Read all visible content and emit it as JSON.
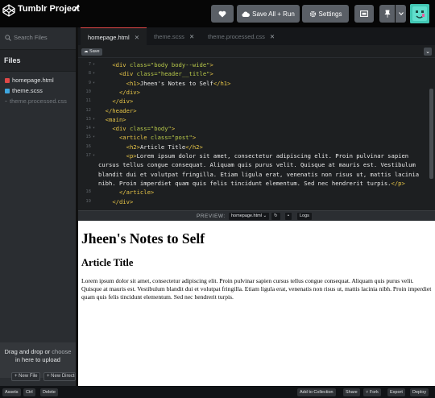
{
  "header": {
    "project_title": "Tumblr Project",
    "save_all_label": "Save All + Run",
    "settings_label": "Settings"
  },
  "sidebar": {
    "search_placeholder": "Search Files",
    "files_heading": "Files",
    "files": [
      {
        "name": "homepage.html",
        "color": "#e04848"
      },
      {
        "name": "theme.scss",
        "color": "#3fa7e0"
      },
      {
        "name": "theme.processed.css",
        "color": "#555a5f"
      }
    ],
    "upload_text_1": "Drag and drop or",
    "upload_link": "choose",
    "upload_text_2": "in here to upload",
    "new_file_label": "+ New File",
    "new_directory_label": "+ New Directo"
  },
  "tabs": [
    {
      "label": "homepage.html",
      "active": true
    },
    {
      "label": "theme.scss",
      "active": false
    },
    {
      "label": "theme.processed.css",
      "active": false
    }
  ],
  "editor": {
    "save_label": "Save",
    "lines": [
      {
        "num": "7",
        "fold": "▾",
        "indent": "    ",
        "parts": [
          [
            "tag",
            "<div "
          ],
          [
            "attr",
            "class="
          ],
          [
            "str",
            "\"body body--wide\""
          ],
          [
            "tag",
            ">"
          ]
        ]
      },
      {
        "num": "8",
        "fold": "▾",
        "indent": "      ",
        "parts": [
          [
            "tag",
            "<div "
          ],
          [
            "attr",
            "class="
          ],
          [
            "str",
            "\"header__title\""
          ],
          [
            "tag",
            ">"
          ]
        ]
      },
      {
        "num": "9",
        "fold": "▾",
        "indent": "        ",
        "parts": [
          [
            "tag",
            "<h1>"
          ],
          [
            "txt",
            "Jheen's Notes to Self"
          ],
          [
            "tag",
            "</h1>"
          ]
        ]
      },
      {
        "num": "10",
        "fold": "",
        "indent": "      ",
        "parts": [
          [
            "tag",
            "</div>"
          ]
        ]
      },
      {
        "num": "11",
        "fold": "",
        "indent": "    ",
        "parts": [
          [
            "tag",
            "</div>"
          ]
        ]
      },
      {
        "num": "12",
        "fold": "",
        "indent": "  ",
        "parts": [
          [
            "tag",
            "</header>"
          ]
        ]
      },
      {
        "num": "13",
        "fold": "▾",
        "indent": "  ",
        "parts": [
          [
            "tag",
            "<main>"
          ]
        ]
      },
      {
        "num": "14",
        "fold": "▾",
        "indent": "    ",
        "parts": [
          [
            "tag",
            "<div "
          ],
          [
            "attr",
            "class="
          ],
          [
            "str",
            "\"body\""
          ],
          [
            "tag",
            ">"
          ]
        ]
      },
      {
        "num": "15",
        "fold": "▾",
        "indent": "      ",
        "parts": [
          [
            "tag",
            "<article "
          ],
          [
            "attr",
            "class="
          ],
          [
            "str",
            "\"post\""
          ],
          [
            "tag",
            ">"
          ]
        ]
      },
      {
        "num": "16",
        "fold": "",
        "indent": "        ",
        "parts": [
          [
            "tag",
            "<h2>"
          ],
          [
            "txt",
            "Article Title"
          ],
          [
            "tag",
            "</h2>"
          ]
        ]
      },
      {
        "num": "17",
        "fold": "▾",
        "indent": "        ",
        "parts": [
          [
            "tag",
            "<p>"
          ],
          [
            "txt",
            "Lorem ipsum dolor sit amet, consectetur adipiscing elit. Proin pulvinar sapien"
          ]
        ]
      },
      {
        "num": "",
        "fold": "",
        "indent": "",
        "parts": [
          [
            "txt",
            "cursus tellus congue consequat. Aliquam quis purus velit. Quisque at mauris est. Vestibulum"
          ]
        ]
      },
      {
        "num": "",
        "fold": "",
        "indent": "",
        "parts": [
          [
            "txt",
            "blandit dui et volutpat fringilla. Etiam ligula erat, venenatis non risus ut, mattis lacinia"
          ]
        ]
      },
      {
        "num": "",
        "fold": "",
        "indent": "",
        "parts": [
          [
            "txt",
            "nibh. Proin imperdiet quam quis felis tincidunt elementum. Sed nec hendrerit turpis."
          ],
          [
            "tag",
            "</p>"
          ]
        ]
      },
      {
        "num": "18",
        "fold": "",
        "indent": "      ",
        "parts": [
          [
            "tag",
            "</article>"
          ]
        ]
      },
      {
        "num": "19",
        "fold": "",
        "indent": "    ",
        "parts": [
          [
            "tag",
            "</div>"
          ]
        ]
      }
    ]
  },
  "preview_bar": {
    "label": "PREVIEW:",
    "file_select": "homepage.html",
    "logs_label": "Logs"
  },
  "preview": {
    "h1": "Jheen's Notes to Self",
    "h2": "Article Title",
    "paragraph": "Lorem ipsum dolor sit amet, consectetur adipiscing elit. Proin pulvinar sapien cursus tellus congue consequat. Aliquam quis purus velit. Quisque at mauris est. Vestibulum blandit dui et volutpat fringilla. Etiam ligula erat, venenatis non risus ut, mattis lacinia nibh. Proin imperdiet quam quis felis tincidunt elementum. Sed nec hendrerit turpis."
  },
  "bottom_bar": {
    "left": [
      "Assets",
      "Ctrl",
      "Delete"
    ],
    "right": [
      "Add to Collection",
      "Share",
      "Fork",
      "Export",
      "Deploy"
    ]
  },
  "colors": {
    "accent_red": "#e04848",
    "avatar_teal": "#42c7b4"
  }
}
